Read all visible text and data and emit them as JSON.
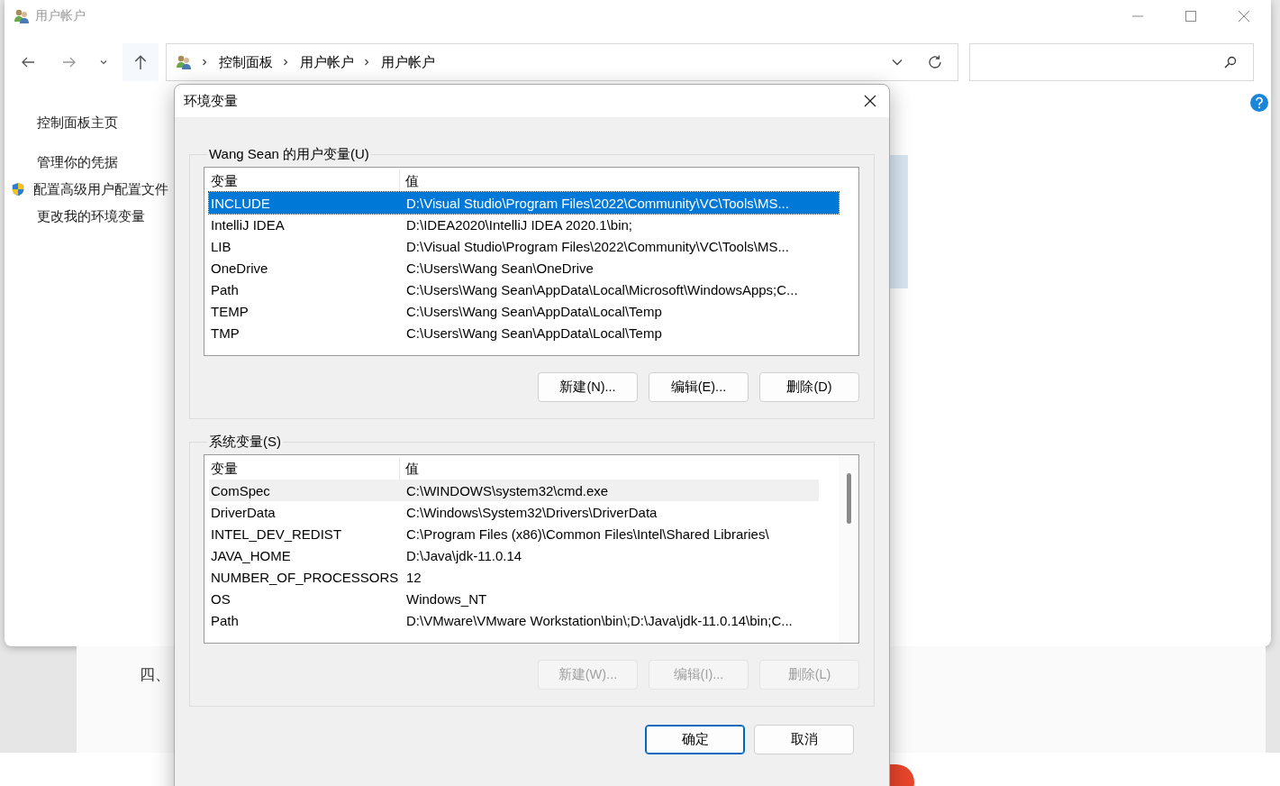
{
  "explorer": {
    "title": "用户帐户",
    "breadcrumb": [
      "控制面板",
      "用户帐户",
      "用户帐户"
    ],
    "sidebar": [
      {
        "label": "控制面板主页",
        "kind": "link"
      },
      {
        "label": "管理你的凭据",
        "kind": "link"
      },
      {
        "label": "配置高级用户配置文件",
        "kind": "shield"
      },
      {
        "label": "更改我的环境变量",
        "kind": "link"
      }
    ]
  },
  "page_behind": {
    "heading": "四、"
  },
  "dialog": {
    "title": "环境变量",
    "groups": [
      {
        "label": "Wang Sean 的用户变量(U)",
        "columns": [
          "变量",
          "值"
        ],
        "scrollbar": false,
        "rows": [
          {
            "name": "INCLUDE",
            "value": "D:\\Visual Studio\\Program Files\\2022\\Community\\VC\\Tools\\MS...",
            "selected": true
          },
          {
            "name": "IntelliJ IDEA",
            "value": "D:\\IDEA2020\\IntelliJ IDEA 2020.1\\bin;",
            "selected": false
          },
          {
            "name": "LIB",
            "value": "D:\\Visual Studio\\Program Files\\2022\\Community\\VC\\Tools\\MS...",
            "selected": false
          },
          {
            "name": "OneDrive",
            "value": "C:\\Users\\Wang Sean\\OneDrive",
            "selected": false
          },
          {
            "name": "Path",
            "value": "C:\\Users\\Wang Sean\\AppData\\Local\\Microsoft\\WindowsApps;C...",
            "selected": false
          },
          {
            "name": "TEMP",
            "value": "C:\\Users\\Wang Sean\\AppData\\Local\\Temp",
            "selected": false
          },
          {
            "name": "TMP",
            "value": "C:\\Users\\Wang Sean\\AppData\\Local\\Temp",
            "selected": false
          }
        ],
        "buttons": [
          {
            "label": "新建(N)...",
            "disabled": false
          },
          {
            "label": "编辑(E)...",
            "disabled": false
          },
          {
            "label": "删除(D)",
            "disabled": false
          }
        ]
      },
      {
        "label": "系统变量(S)",
        "columns": [
          "变量",
          "值"
        ],
        "scrollbar": true,
        "rows": [
          {
            "name": "ComSpec",
            "value": "C:\\WINDOWS\\system32\\cmd.exe",
            "selected": true
          },
          {
            "name": "DriverData",
            "value": "C:\\Windows\\System32\\Drivers\\DriverData",
            "selected": false
          },
          {
            "name": "INTEL_DEV_REDIST",
            "value": "C:\\Program Files (x86)\\Common Files\\Intel\\Shared Libraries\\",
            "selected": false
          },
          {
            "name": "JAVA_HOME",
            "value": "D:\\Java\\jdk-11.0.14",
            "selected": false
          },
          {
            "name": "NUMBER_OF_PROCESSORS",
            "value": "12",
            "selected": false
          },
          {
            "name": "OS",
            "value": "Windows_NT",
            "selected": false
          },
          {
            "name": "Path",
            "value": "D:\\VMware\\VMware Workstation\\bin\\;D:\\Java\\jdk-11.0.14\\bin;C...",
            "selected": false
          }
        ],
        "buttons": [
          {
            "label": "新建(W)...",
            "disabled": true
          },
          {
            "label": "编辑(I)...",
            "disabled": true
          },
          {
            "label": "删除(L)",
            "disabled": true
          }
        ]
      }
    ],
    "buttons": [
      {
        "label": "确定",
        "default": true
      },
      {
        "label": "取消",
        "default": false
      }
    ]
  }
}
